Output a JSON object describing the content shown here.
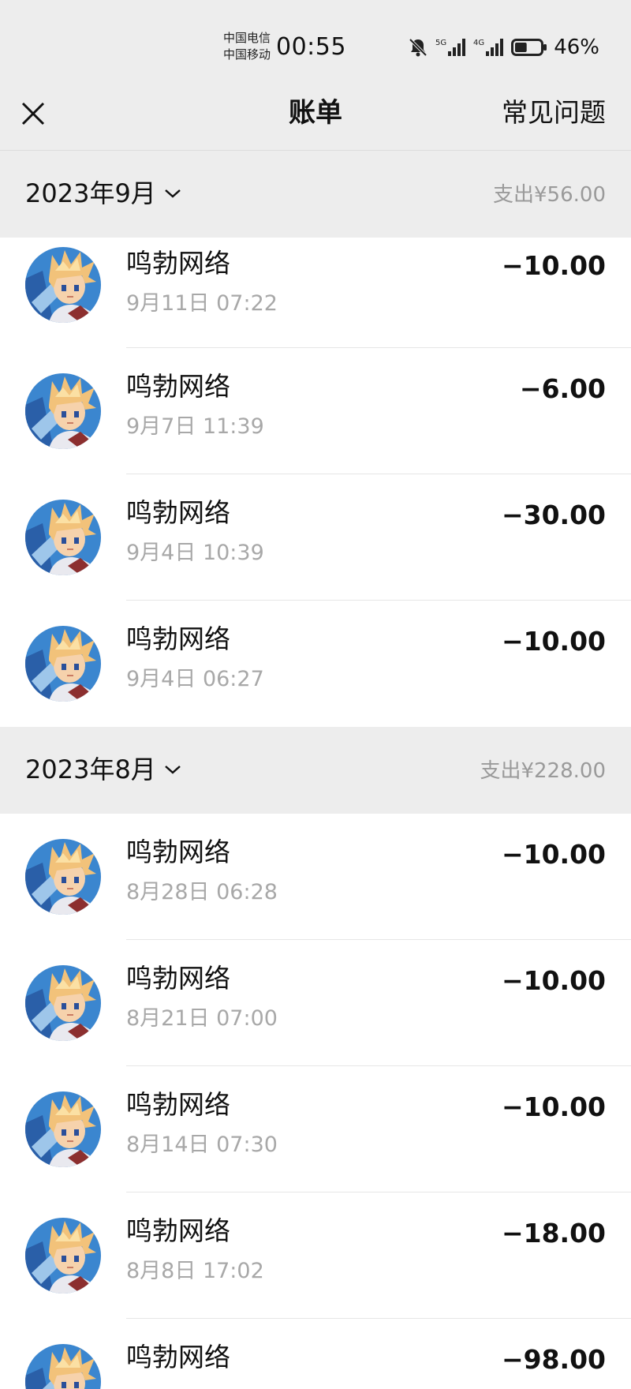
{
  "status_bar": {
    "carrier_1": "中国电信",
    "carrier_2": "中国移动",
    "time": "00:55",
    "signal_1_label": "5G",
    "signal_2_label": "4G",
    "battery_percent": "46%",
    "battery_level": 0.46
  },
  "nav": {
    "title": "账单",
    "faq_label": "常见问题"
  },
  "sections": [
    {
      "month": "2023年9月",
      "spent": "支出¥56.00",
      "items": [
        {
          "merchant": "鸣勃网络",
          "time": "9月11日 07:22",
          "amount": "−10.00"
        },
        {
          "merchant": "鸣勃网络",
          "time": "9月7日 11:39",
          "amount": "−6.00"
        },
        {
          "merchant": "鸣勃网络",
          "time": "9月4日 10:39",
          "amount": "−30.00"
        },
        {
          "merchant": "鸣勃网络",
          "time": "9月4日 06:27",
          "amount": "−10.00"
        }
      ]
    },
    {
      "month": "2023年8月",
      "spent": "支出¥228.00",
      "items": [
        {
          "merchant": "鸣勃网络",
          "time": "8月28日 06:28",
          "amount": "−10.00"
        },
        {
          "merchant": "鸣勃网络",
          "time": "8月21日 07:00",
          "amount": "−10.00"
        },
        {
          "merchant": "鸣勃网络",
          "time": "8月14日 07:30",
          "amount": "−10.00"
        },
        {
          "merchant": "鸣勃网络",
          "time": "8月8日 17:02",
          "amount": "−18.00"
        },
        {
          "merchant": "鸣勃网络",
          "time": "",
          "amount": "−98.00"
        }
      ]
    }
  ],
  "icons": {
    "close": "close-icon",
    "chevron": "chevron-down-icon",
    "avatar": "merchant-avatar"
  },
  "colors": {
    "background": "#ededed",
    "list_background": "#ffffff",
    "secondary_text": "#a8a8a8"
  }
}
